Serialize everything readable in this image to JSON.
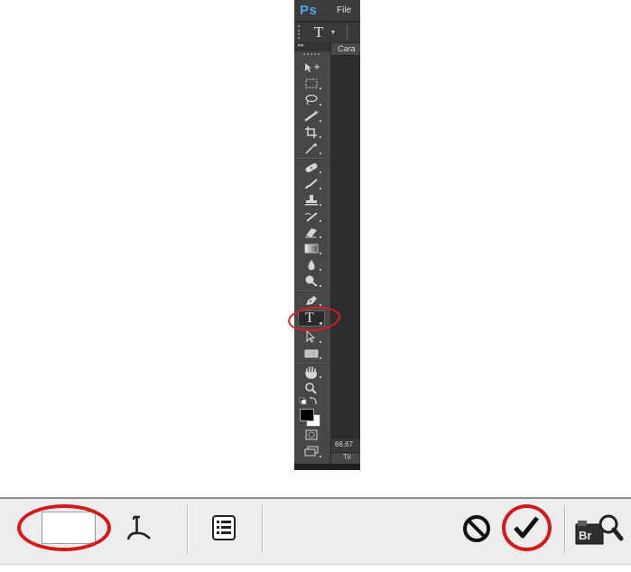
{
  "app": {
    "logo": "Ps",
    "menu": {
      "file": "File"
    },
    "options_bar": {
      "active_tool_glyph": "T",
      "caret_glyph": "▾"
    },
    "toolbox": {
      "collapse_glyph": "▸▸",
      "tools": [
        "move-icon",
        "marquee-icon",
        "lasso-icon",
        "quick-selection-icon",
        "crop-icon",
        "eyedropper-icon",
        "healing-brush-icon",
        "brush-icon",
        "clone-stamp-icon",
        "history-brush-icon",
        "eraser-icon",
        "gradient-icon",
        "blur-icon",
        "dodge-icon",
        "pen-icon",
        "type-icon",
        "path-selection-icon",
        "rectangle-icon",
        "hand-icon",
        "zoom-icon",
        "default-colors-icon",
        "swap-colors-icon",
        "quick-mask-icon",
        "screen-mode-icon"
      ],
      "type_tool": {
        "glyph": "T",
        "highlighted": true
      }
    },
    "document": {
      "tab_label": "Cara",
      "zoom_label": "66,67",
      "bottom_tab_label": "Tir"
    },
    "colors": {
      "foreground": "#000000",
      "background": "#ffffff",
      "ui_dark": "#282828",
      "toolbox": "#474747",
      "logo_blue": "#4ea9e6",
      "highlight_red": "#d62020"
    }
  },
  "options_toolbar": {
    "items": [
      {
        "name": "text-color-swatch",
        "highlighted": true
      },
      {
        "name": "warp-text-icon"
      },
      {
        "name": "character-paragraph-panel-icon"
      },
      {
        "name": "cancel-icon"
      },
      {
        "name": "commit-checkmark-icon",
        "highlighted": true
      },
      {
        "name": "bridge-search-icon",
        "label": "Br"
      }
    ]
  }
}
